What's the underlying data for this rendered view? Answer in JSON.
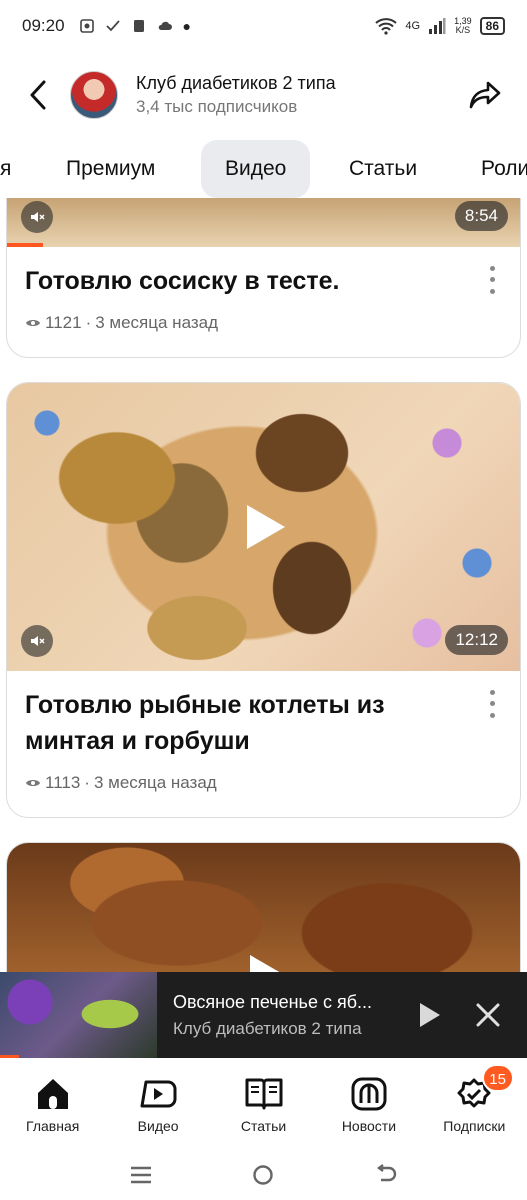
{
  "status_bar": {
    "time": "09:20",
    "network": "4G",
    "speed_value": "1,39",
    "speed_unit": "K/S",
    "battery": "86"
  },
  "header": {
    "channel_name": "Клуб диабетиков 2 типа",
    "subscribers": "3,4 тыс подписчиков"
  },
  "tabs": [
    {
      "label": "я"
    },
    {
      "label": "Премиум"
    },
    {
      "label": "Видео",
      "active": true
    },
    {
      "label": "Статьи"
    },
    {
      "label": "Роли"
    }
  ],
  "cards": [
    {
      "title": "Готовлю сосиску в тесте.",
      "views": "1121",
      "separator": "·",
      "age": "3 месяца назад",
      "duration": "8:54"
    },
    {
      "title": "Готовлю рыбные котлеты из минтая и горбуши",
      "views": "1113",
      "separator": "·",
      "age": "3 месяца назад",
      "duration": "12:12"
    },
    {
      "title": "",
      "views": "",
      "age": ""
    }
  ],
  "mini_player": {
    "title": "Овсяное печенье с яб...",
    "channel": "Клуб диабетиков 2 типа",
    "progress": 0.12
  },
  "bottom_nav": [
    {
      "label": "Главная",
      "icon": "home-icon"
    },
    {
      "label": "Видео",
      "icon": "video-icon"
    },
    {
      "label": "Статьи",
      "icon": "articles-icon"
    },
    {
      "label": "Новости",
      "icon": "news-icon"
    },
    {
      "label": "Подписки",
      "icon": "subscriptions-icon",
      "badge": "15"
    }
  ],
  "colors": {
    "accent": "#ff5a1f",
    "active_tab_bg": "#e9ebee",
    "mini_player_bg": "#1e1e1e"
  }
}
